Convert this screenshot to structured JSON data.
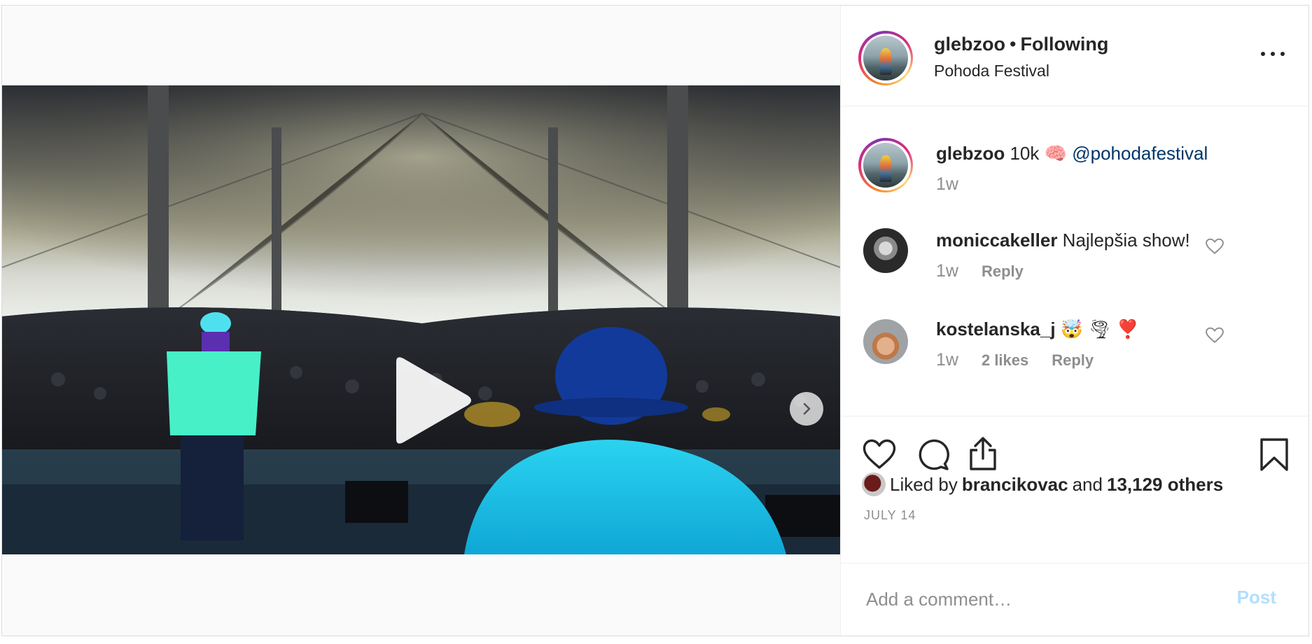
{
  "post": {
    "header": {
      "username": "glebzoo",
      "separator": "•",
      "follow_status": "Following",
      "location": "Pohoda Festival",
      "more_icon": "more-options-icon"
    },
    "caption": {
      "username": "glebzoo",
      "text": "10k 🧠",
      "mention": "@pohodafestival",
      "time": "1w"
    },
    "comments": [
      {
        "username": "moniccakeller",
        "text": "Najlepšia show!",
        "time": "1w",
        "reply_label": "Reply"
      },
      {
        "username": "kostelanska_j",
        "text": "🤯 🌪 ❣️",
        "time": "1w",
        "likes": "2 likes",
        "reply_label": "Reply"
      }
    ],
    "likes": {
      "prefix": "Liked by",
      "user": "brancikovac",
      "joiner": "and",
      "others": "13,129 others"
    },
    "date": "JULY 14",
    "add_comment": {
      "placeholder": "Add a comment…",
      "post_label": "Post"
    },
    "media": {
      "type": "video",
      "slide_count": 2,
      "current_slide": 1
    }
  },
  "colors": {
    "link": "#003569",
    "muted": "#8e8e8e",
    "post_disabled": "#b2dffc",
    "text": "#262626"
  }
}
